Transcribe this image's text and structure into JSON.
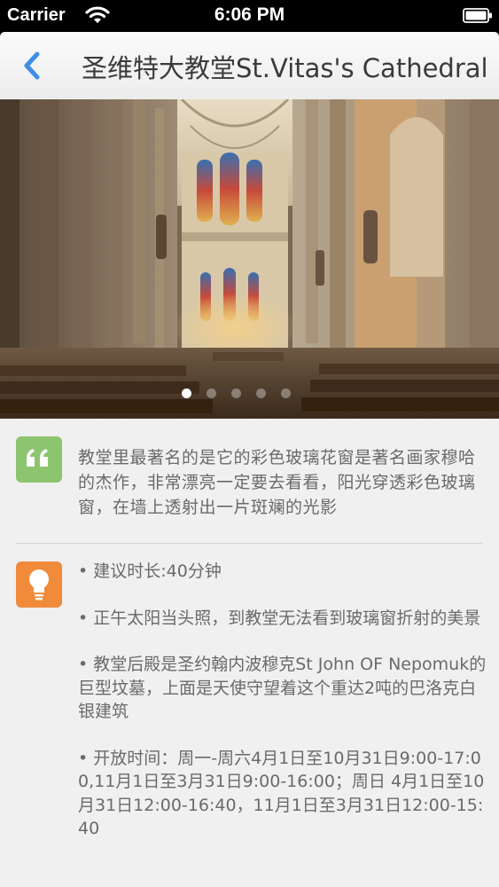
{
  "status_bar": {
    "carrier": "Carrier",
    "time": "6:06 PM"
  },
  "nav": {
    "title": "圣维特大教堂St.Vitas's Cathedral"
  },
  "hero": {
    "page_count": 5,
    "current_page": 1
  },
  "quote": {
    "text": "教堂里最著名的是它的彩色玻璃花窗是著名画家穆哈的杰作，非常漂亮一定要去看看，阳光穿透彩色玻璃窗，在墙上透射出一片斑斓的光影"
  },
  "tips": [
    "• 建议时长:40分钟",
    "• 正午太阳当头照，到教堂无法看到玻璃窗折射的美景",
    "• 教堂后殿是圣约翰内波穆克St John OF Nepomuk的巨型坟墓，上面是天使守望着这个重达2吨的巴洛克白银建筑",
    "• 开放时间：周一-周六4月1日至10月31日9:00-17:00,11月1日至3月31日9:00-16:00；周日 4月1日至10月31日12:00-16:40，11月1日至3月31日12:00-15:40"
  ],
  "icons": {
    "back": "chevron-left-icon",
    "quote": "quote-icon",
    "tip": "lightbulb-icon",
    "wifi": "wifi-icon",
    "battery": "battery-icon"
  },
  "colors": {
    "accent": "#3d8ee6",
    "quote_tile": "#8cc46f",
    "tip_tile": "#f08b3c",
    "text": "#6a6a6a",
    "background": "#f0f0f0"
  }
}
